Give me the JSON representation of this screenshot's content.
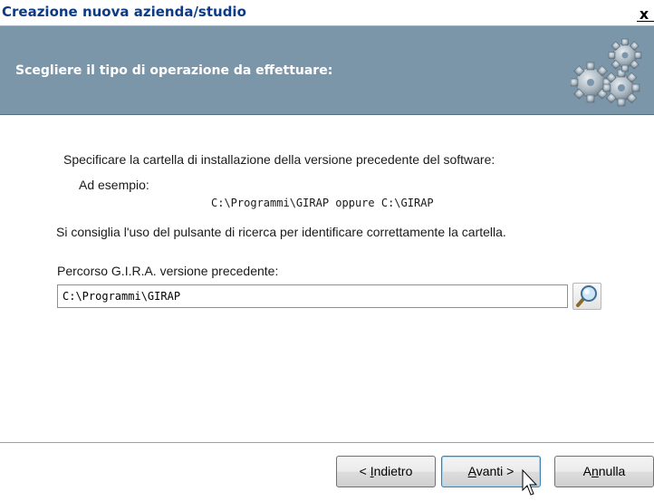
{
  "window": {
    "title": "Creazione nuova azienda/studio",
    "close_label": "x"
  },
  "header": {
    "heading": "Scegliere il tipo di operazione da effettuare:"
  },
  "content": {
    "instruction": "Specificare la cartella di installazione della versione precedente del software:",
    "example_label": "Ad esempio:",
    "example_value": "C:\\Programmi\\GIRAP oppure C:\\GIRAP",
    "hint": "Si consiglia l'uso del pulsante di ricerca per identificare correttamente la cartella.",
    "path_label": "Percorso G.I.R.A. versione precedente:",
    "path_value": "C:\\Programmi\\GIRAP"
  },
  "buttons": {
    "back": {
      "pre": "< ",
      "accel": "I",
      "rest": "ndietro"
    },
    "next": {
      "pre": "",
      "accel": "A",
      "rest": "vanti >"
    },
    "cancel": {
      "pre": "A",
      "accel": "n",
      "rest": "nulla"
    }
  },
  "icons": {
    "header_graphic": "gears-icon",
    "search_button": "magnifier-icon",
    "pointer": "mouse-cursor"
  },
  "colors": {
    "title_text": "#0c3b86",
    "header_band": "#7c96a9",
    "header_text": "#ffffff",
    "focus_border": "#3c7fb1"
  }
}
